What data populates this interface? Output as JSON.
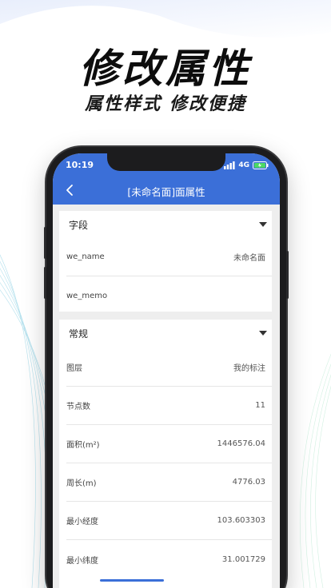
{
  "promo": {
    "title": "修改属性",
    "subtitle": "属性样式 修改便捷"
  },
  "status_bar": {
    "time": "10:19",
    "network": "4G"
  },
  "appbar": {
    "title": "[未命名面]面属性"
  },
  "fields_section": {
    "header": "字段",
    "rows": [
      {
        "key": "we_name",
        "value": "未命名面"
      },
      {
        "key": "we_memo",
        "value": ""
      }
    ]
  },
  "general_section": {
    "header": "常规",
    "rows": [
      {
        "key": "图层",
        "value": "我的标注"
      },
      {
        "key": "节点数",
        "value": "11"
      },
      {
        "key": "面积(m²)",
        "value": "1446576.04"
      },
      {
        "key": "周长(m)",
        "value": "4776.03"
      },
      {
        "key": "最小经度",
        "value": "103.603303"
      },
      {
        "key": "最小纬度",
        "value": "31.001729"
      }
    ]
  },
  "colors": {
    "accent": "#3b6fd8",
    "background": "#eeeeee"
  }
}
